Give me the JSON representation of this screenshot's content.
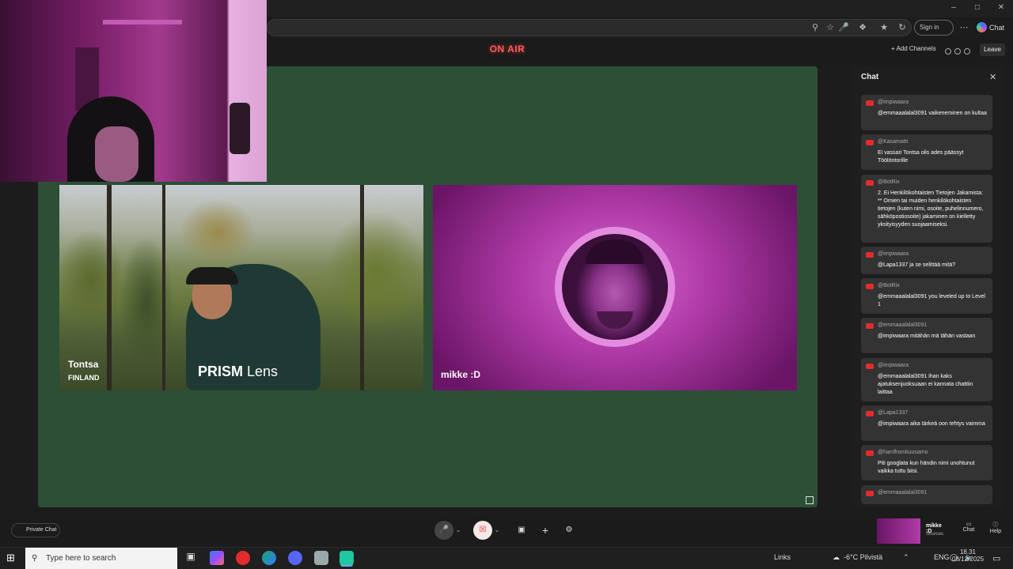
{
  "browser": {
    "signin_label": "Sign in",
    "copilot_label": "Chat",
    "window_controls": [
      "minimize-icon",
      "restore-icon",
      "close-icon"
    ]
  },
  "studio": {
    "on_air_label": "ON AIR",
    "add_channels_label": "+ Add Channels",
    "leave_label": "Leave"
  },
  "stage": {
    "participants": [
      {
        "name": "Tontsa",
        "subtitle": "FINLAND",
        "lens_label_bold": "PRISM",
        "lens_label": " Lens"
      },
      {
        "name": "mikke :D"
      }
    ]
  },
  "chat": {
    "title": "Chat",
    "messages": [
      {
        "user": "@impiwaara",
        "text": "@emmaaalalal3091 vaikeneminen on kultaa"
      },
      {
        "user": "@Kasamatti",
        "text": "Ei vassari Tontsa olis ades päässyt Töölöntorille"
      },
      {
        "user": "@BotRix",
        "text": "2. Ei Henkilökohtaisten Tietojen Jakamista: ** Omien tai muiden henkilökohtaisten tietojen (kuten nimi, osoite, puhelinnumero, sähköpostiosoite) jakaminen on kielletty yksityisyyden suojaamiseksi."
      },
      {
        "user": "@impiwaara",
        "text": "@Lapa1337 ja se selittää mitä?"
      },
      {
        "user": "@BotRix",
        "text": "@emmaaalalal3091 you leveled up to Level 1"
      },
      {
        "user": "@emmaaalalal3091",
        "text": "@impiwaara mitähän mä tähän vastaan"
      },
      {
        "user": "@impiwaara",
        "text": "@emmaaalalal3091 ihan kaks ajatuksenjuoksuaan ei kannata chattiin laittaa"
      },
      {
        "user": "@Lapa1337",
        "text": "@impiwaara aika tärkeä oon tehtys vaimma"
      },
      {
        "user": "@harrifromkuusamo",
        "text": "Piti googlata kun händin nimi unohtunut vaikka tuttu biisi."
      },
      {
        "user": "@emmaaalalal3091",
        "text": ""
      }
    ]
  },
  "controls": {
    "private_chat_label": "Private Chat",
    "source_name": "mikke :D",
    "source_sub": "Sources",
    "chat_label": "Chat",
    "help_label": "Help"
  },
  "taskbar": {
    "search_placeholder": "Type here to search",
    "links_label": "Links",
    "weather": "-6°C Pilvistä",
    "language": "ENG",
    "time": "18.31",
    "date": "08/12/2025"
  }
}
